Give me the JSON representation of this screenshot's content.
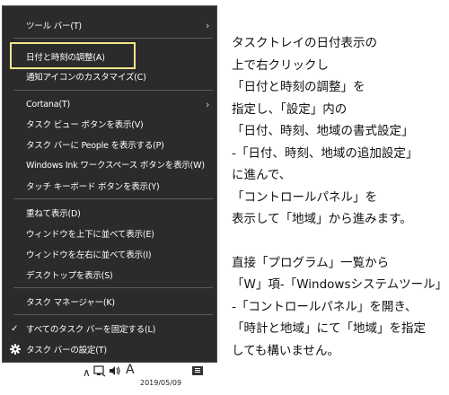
{
  "menu": {
    "items": [
      {
        "label": "ツール バー(T)",
        "submenu": true
      },
      {
        "label": "日付と時刻の調整(A)"
      },
      {
        "label": "通知アイコンのカスタマイズ(C)"
      },
      {
        "label": "Cortana(T)",
        "submenu": true
      },
      {
        "label": "タスク ビュー ボタンを表示(V)"
      },
      {
        "label": "タスク バーに People を表示する(P)"
      },
      {
        "label": "Windows Ink ワークスペース ボタンを表示(W)"
      },
      {
        "label": "タッチ キーボード ボタンを表示(Y)"
      },
      {
        "label": "重ねて表示(D)"
      },
      {
        "label": "ウィンドウを上下に並べて表示(E)"
      },
      {
        "label": "ウィンドウを左右に並べて表示(I)"
      },
      {
        "label": "デスクトップを表示(S)"
      },
      {
        "label": "タスク マネージャー(K)"
      },
      {
        "label": "すべてのタスク バーを固定する(L)",
        "checked": true
      },
      {
        "label": "タスク バーの設定(T)",
        "icon": "gear-icon"
      }
    ],
    "highlight_color": "#f0e68c"
  },
  "taskbar": {
    "ime_indicator": "A",
    "date": "2019/05/09",
    "icons": [
      "chevron-up-icon",
      "network-icon",
      "volume-icon",
      "notification-icon"
    ]
  },
  "instructions": {
    "paragraph1": [
      "タスクトレイの日付表示の",
      "上で右クリックし",
      "「日付と時刻の調整」を",
      "指定し、「設定」内の",
      "「日付、時刻、地域の書式設定」",
      "-「日付、時刻、地域の追加設定」",
      "に進んで、",
      "「コントロールパネル」を",
      "表示して「地域」から進みます。"
    ],
    "paragraph2": [
      "直接「プログラム」一覧から",
      "「W」項-「Windowsシステムツール」",
      "-「コントロールパネル」を開き、",
      "「時計と地域」にて「地域」を指定",
      "しても構いません。"
    ]
  }
}
